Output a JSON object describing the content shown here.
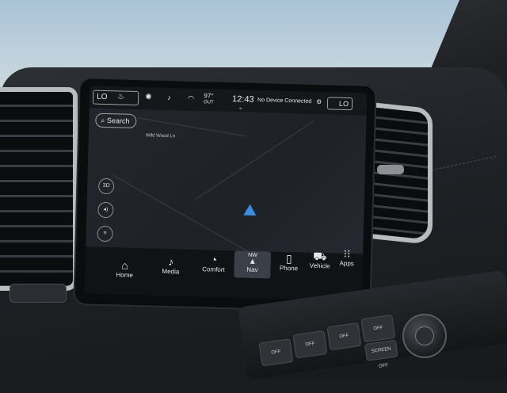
{
  "status_bar": {
    "left_temp": "LO",
    "right_temp": "LO",
    "outside_temp": "97°",
    "outside_label": "OUT",
    "clock": "12:43",
    "device_status": "No Device Connected"
  },
  "map": {
    "search_label": "Search",
    "street_label": "Wild Wood Ln",
    "view_mode": "3D",
    "heading": "NW"
  },
  "dock": {
    "items": [
      {
        "label": "Home",
        "icon": "house-icon"
      },
      {
        "label": "Media",
        "icon": "music-note-icon"
      },
      {
        "label": "Comfort",
        "icon": "seat-icon"
      },
      {
        "label": "Nav",
        "icon": "nav-arrow-icon"
      },
      {
        "label": "Phone",
        "icon": "phone-icon"
      },
      {
        "label": "Vehicle",
        "icon": "car-icon"
      },
      {
        "label": "Apps",
        "icon": "grid-icon"
      }
    ]
  },
  "console": {
    "buttons": [
      "OFF",
      "OFF",
      "OFF",
      "OFF"
    ],
    "screen_off_label": "SCREEN OFF"
  },
  "colors": {
    "screen_bg": "#1b1d22",
    "nav_arrow": "#3b8ee8",
    "dock_active": "#3a3f48"
  }
}
